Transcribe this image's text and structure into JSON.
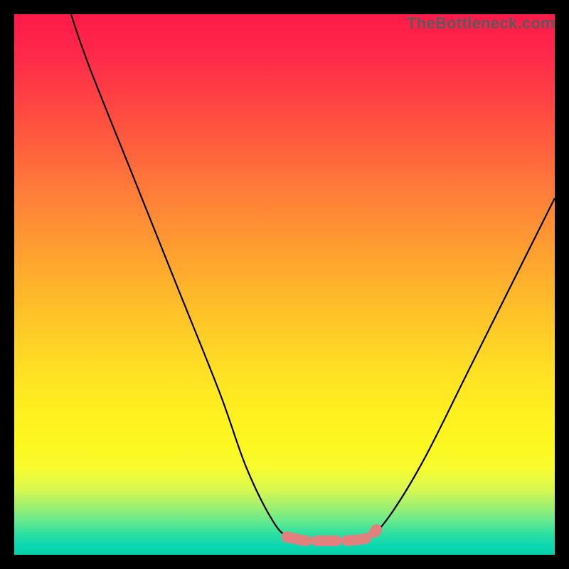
{
  "watermark": "TheBottleneck.com",
  "colors": {
    "frame": "#000000",
    "curve": "#000000",
    "marker": "#e28080",
    "gradient_stops": [
      {
        "pos": 0.0,
        "hex": "#ff1a4a"
      },
      {
        "pos": 0.2,
        "hex": "#ff5040"
      },
      {
        "pos": 0.44,
        "hex": "#ffa030"
      },
      {
        "pos": 0.66,
        "hex": "#ffe024"
      },
      {
        "pos": 0.84,
        "hex": "#f8fc30"
      },
      {
        "pos": 0.94,
        "hex": "#60e890"
      },
      {
        "pos": 1.0,
        "hex": "#00d0a8"
      }
    ]
  },
  "chart_data": {
    "type": "line",
    "title": "",
    "xlabel": "",
    "ylabel": "",
    "x_range_displayed": [
      0,
      100
    ],
    "y_range_displayed": [
      0,
      100
    ],
    "notes": "Two monotone black curves descend from the top edges into a flat valley near the bottom center. Valley is highlighted by thick rounded salmon markers. Axes and tick labels are not rendered; curve coordinates below are estimated in percent of the plot area.",
    "series": [
      {
        "name": "left-branch",
        "values": [
          {
            "x": 10.5,
            "y": 100
          },
          {
            "x": 14,
            "y": 90
          },
          {
            "x": 22,
            "y": 70
          },
          {
            "x": 30,
            "y": 50
          },
          {
            "x": 38,
            "y": 30
          },
          {
            "x": 43,
            "y": 16
          },
          {
            "x": 48,
            "y": 6
          },
          {
            "x": 51,
            "y": 3.2
          },
          {
            "x": 54,
            "y": 2.6
          }
        ]
      },
      {
        "name": "right-branch",
        "values": [
          {
            "x": 63,
            "y": 2.6
          },
          {
            "x": 66,
            "y": 3.4
          },
          {
            "x": 70,
            "y": 8
          },
          {
            "x": 76,
            "y": 18
          },
          {
            "x": 84,
            "y": 34
          },
          {
            "x": 92,
            "y": 50
          },
          {
            "x": 100,
            "y": 66
          }
        ]
      },
      {
        "name": "valley-markers",
        "values": [
          {
            "x": 50.5,
            "y": 3.3
          },
          {
            "x": 54,
            "y": 2.6
          },
          {
            "x": 57,
            "y": 2.6
          },
          {
            "x": 60,
            "y": 2.6
          },
          {
            "x": 63,
            "y": 2.7
          },
          {
            "x": 65.5,
            "y": 3.2
          },
          {
            "x": 67,
            "y": 4.6
          }
        ]
      }
    ]
  }
}
